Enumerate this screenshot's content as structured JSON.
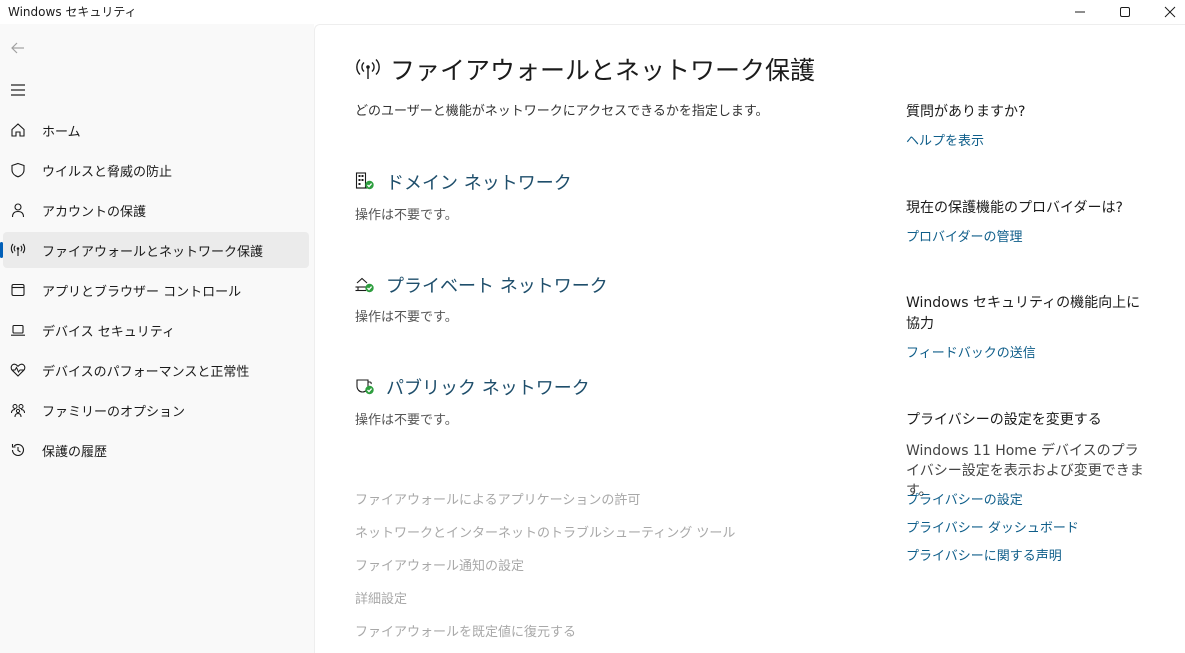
{
  "window": {
    "title": "Windows セキュリティ"
  },
  "sidebar": {
    "items": [
      {
        "label": "ホーム",
        "icon": "home-icon"
      },
      {
        "label": "ウイルスと脅威の防止",
        "icon": "shield-icon"
      },
      {
        "label": "アカウントの保護",
        "icon": "person-icon"
      },
      {
        "label": "ファイアウォールとネットワーク保護",
        "icon": "antenna-icon",
        "active": true
      },
      {
        "label": "アプリとブラウザー コントロール",
        "icon": "app-window-icon"
      },
      {
        "label": "デバイス セキュリティ",
        "icon": "laptop-icon"
      },
      {
        "label": "デバイスのパフォーマンスと正常性",
        "icon": "heart-pulse-icon"
      },
      {
        "label": "ファミリーのオプション",
        "icon": "family-icon"
      },
      {
        "label": "保護の履歴",
        "icon": "history-icon"
      }
    ]
  },
  "main": {
    "title": "ファイアウォールとネットワーク保護",
    "subtitle": "どのユーザーと機能がネットワークにアクセスできるかを指定します。",
    "networks": [
      {
        "title": "ドメイン ネットワーク",
        "status": "操作は不要です。",
        "icon": "domain-network-icon"
      },
      {
        "title": "プライベート ネットワーク",
        "status": "操作は不要です。",
        "icon": "private-network-icon"
      },
      {
        "title": "パブリック ネットワーク",
        "status": "操作は不要です。",
        "icon": "public-network-icon"
      }
    ],
    "links": [
      "ファイアウォールによるアプリケーションの許可",
      "ネットワークとインターネットのトラブルシューティング ツール",
      "ファイアウォール通知の設定",
      "詳細設定",
      "ファイアウォールを既定値に復元する"
    ]
  },
  "right": {
    "help_head": "質問がありますか?",
    "help_link": "ヘルプを表示",
    "provider_head": "現在の保護機能のプロバイダーは?",
    "provider_link": "プロバイダーの管理",
    "improve_head": "Windows セキュリティの機能向上に協力",
    "improve_link": "フィードバックの送信",
    "privacy_head": "プライバシーの設定を変更する",
    "privacy_text": "Windows 11 Home デバイスのプライバシー設定を表示および変更できます。",
    "privacy_links": [
      "プライバシーの設定",
      "プライバシー ダッシュボード",
      "プライバシーに関する声明"
    ]
  },
  "colors": {
    "accent": "#005fb8",
    "link": "#0f5e8a",
    "network_title": "#1e4e6b",
    "ok_badge": "#2e9e3f",
    "disabled_link": "#a8a8a8"
  }
}
